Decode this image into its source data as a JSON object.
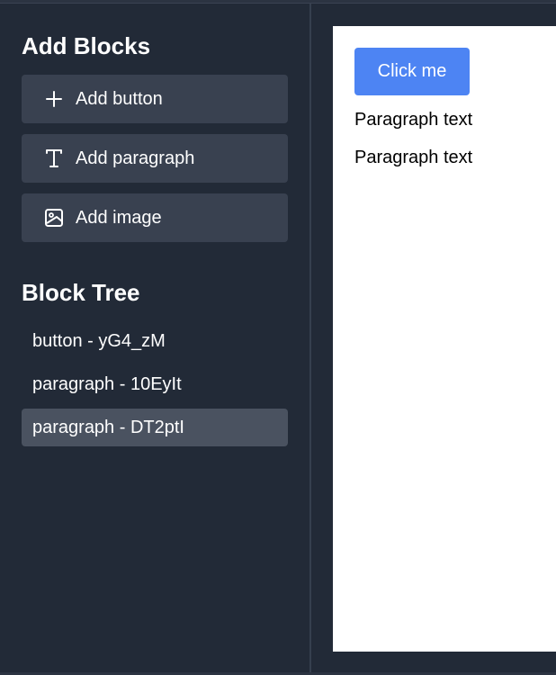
{
  "add_blocks": {
    "title": "Add Blocks",
    "buttons": [
      {
        "label": "Add button",
        "icon": "plus-icon"
      },
      {
        "label": "Add paragraph",
        "icon": "text-icon"
      },
      {
        "label": "Add image",
        "icon": "image-icon"
      }
    ]
  },
  "block_tree": {
    "title": "Block Tree",
    "items": [
      {
        "label": "button - yG4_zM",
        "selected": false
      },
      {
        "label": "paragraph - 10EyIt",
        "selected": false
      },
      {
        "label": "paragraph - DT2ptI",
        "selected": true
      }
    ]
  },
  "canvas": {
    "button_label": "Click me",
    "paragraphs": [
      "Paragraph text",
      "Paragraph text"
    ]
  },
  "colors": {
    "background": "#222a37",
    "button_bg": "#394150",
    "selected_bg": "#4a5260",
    "accent": "#4d84f3",
    "canvas_bg": "#ffffff"
  }
}
